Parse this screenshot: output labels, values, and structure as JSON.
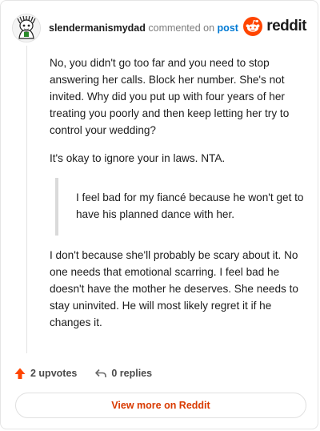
{
  "header": {
    "author": "slendermanismydad",
    "commented_text": "commented on",
    "post_link": "post",
    "brand": "reddit"
  },
  "comment": {
    "paragraph1": "No, you didn't go too far and you need to stop answering her calls. Block her number. She's not invited. Why did you put up with four years of her treating you poorly and then keep letting her try to control your wedding?",
    "paragraph2": "It's okay to ignore your in laws. NTA.",
    "quote": "I feel bad for my fiancé because he won't get to have his planned dance with her.",
    "paragraph3": "I don't because she'll probably be scary about it. No one needs that emotional scarring. I feel bad he doesn't have the mother he deserves. She needs to stay uninvited. He will most likely regret it if he changes it."
  },
  "actions": {
    "upvotes": "2 upvotes",
    "replies": "0 replies"
  },
  "footer": {
    "view_more": "View more on Reddit"
  },
  "colors": {
    "reddit_orange": "#ff4500",
    "upvote": "#ff4500",
    "link_blue": "#0079d3",
    "view_more": "#d93a00"
  },
  "icons": {
    "avatar": "snoo-avatar",
    "brand": "reddit-logo-icon",
    "upvote": "upvote-arrow-icon",
    "reply": "reply-arrow-icon"
  }
}
